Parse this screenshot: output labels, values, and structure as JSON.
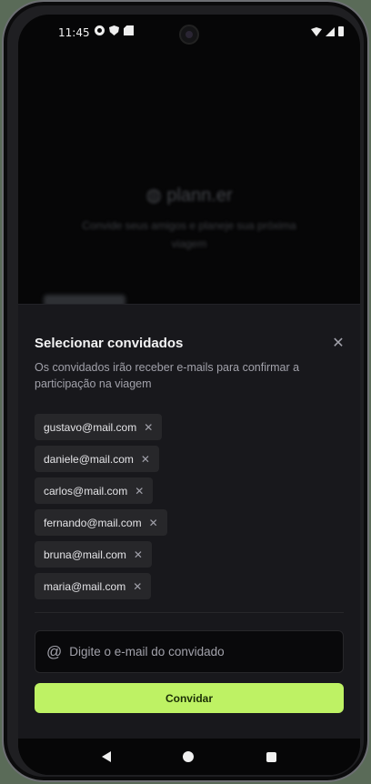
{
  "status_bar": {
    "time": "11:45"
  },
  "background": {
    "logo": "plann.er",
    "tagline": "Convide seus amigos e planeje sua próxima viagem"
  },
  "sheet": {
    "title": "Selecionar convidados",
    "description": "Os convidados irão receber e-mails para confirmar a participação na viagem",
    "guests": [
      {
        "email": "gustavo@mail.com"
      },
      {
        "email": "daniele@mail.com"
      },
      {
        "email": "carlos@mail.com"
      },
      {
        "email": "fernando@mail.com"
      },
      {
        "email": "bruna@mail.com"
      },
      {
        "email": "maria@mail.com"
      }
    ],
    "input": {
      "placeholder": "Digite o e-mail do convidado",
      "value": ""
    },
    "button_label": "Convidar"
  },
  "colors": {
    "accent": "#bef264",
    "sheet_bg": "#18181c",
    "chip_bg": "#27272a"
  },
  "icons": {
    "close": "close-icon",
    "remove": "x-icon",
    "email": "at-icon"
  }
}
